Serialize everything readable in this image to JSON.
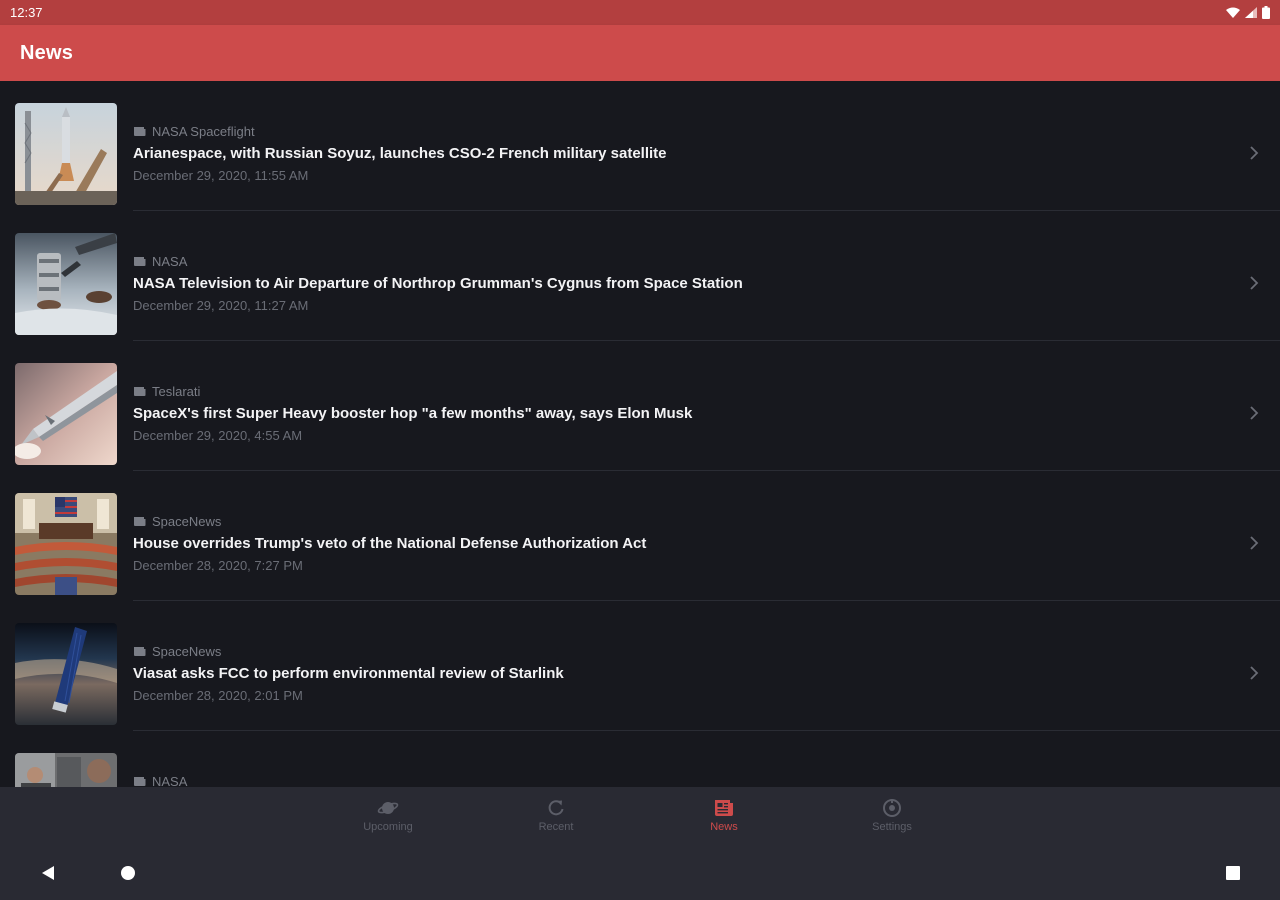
{
  "status_bar": {
    "time": "12:37",
    "icons": [
      "wifi-icon",
      "signal-icon",
      "battery-icon"
    ]
  },
  "app_bar": {
    "title": "News"
  },
  "news": {
    "items": [
      {
        "source": "NASA Spaceflight",
        "title": "Arianespace, with Russian Soyuz, launches CSO-2 French military satellite",
        "date": "December 29, 2020, 11:55 AM",
        "thumbnail": "rocket-on-launchpad-photo"
      },
      {
        "source": "NASA",
        "title": "NASA Television to Air Departure of Northrop Grumman's Cygnus from Space Station",
        "date": "December 29, 2020, 11:27 AM",
        "thumbnail": "cygnus-spacecraft-robotic-arm-photo"
      },
      {
        "source": "Teslarati",
        "title": "SpaceX's first Super Heavy booster hop \"a few months\" away, says Elon Musk",
        "date": "December 29, 2020, 4:55 AM",
        "thumbnail": "starship-render-photo"
      },
      {
        "source": "SpaceNews",
        "title": "House overrides Trump's veto of the National Defense Authorization Act",
        "date": "December 28, 2020, 7:27 PM",
        "thumbnail": "house-chamber-photo"
      },
      {
        "source": "SpaceNews",
        "title": "Viasat asks FCC to perform environmental review of Starlink",
        "date": "December 28, 2020, 2:01 PM",
        "thumbnail": "starlink-satellite-photo"
      },
      {
        "source": "NASA",
        "title": "",
        "date": "",
        "thumbnail": "space-station-crew-photo"
      }
    ]
  },
  "bottom_nav": {
    "items": [
      {
        "label": "Upcoming",
        "icon": "planet-icon",
        "active": false
      },
      {
        "label": "Recent",
        "icon": "refresh-icon",
        "active": false
      },
      {
        "label": "News",
        "icon": "newspaper-icon",
        "active": true
      },
      {
        "label": "Settings",
        "icon": "gear-icon",
        "active": false
      }
    ]
  },
  "system_nav": {
    "buttons": [
      "back-icon",
      "home-icon",
      "recents-icon"
    ]
  },
  "colors": {
    "accent": "#cd4b4b",
    "status_bar": "#b33f3f",
    "background": "#17181e",
    "nav_background": "#292a33",
    "title_text": "#f3f3f5",
    "secondary_text": "#7b7e87"
  }
}
